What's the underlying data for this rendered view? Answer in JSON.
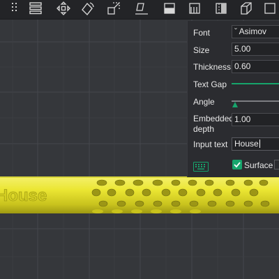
{
  "toolbar": {
    "tools": [
      {
        "icon": "grip-icon"
      },
      {
        "icon": "menu-icon"
      },
      {
        "icon": "move-icon"
      },
      {
        "icon": "rotate-icon"
      },
      {
        "icon": "scale-icon"
      },
      {
        "icon": "lay-flat-icon"
      },
      {
        "icon": "cut-icon"
      },
      {
        "icon": "support-paint-icon"
      },
      {
        "icon": "seam-paint-icon"
      },
      {
        "icon": "color-paint-icon"
      },
      {
        "icon": "measure-icon"
      },
      {
        "icon": "text-shape-icon"
      }
    ]
  },
  "panel": {
    "font_label": "Font",
    "font_value": "Asimov",
    "size_label": "Size",
    "size_value": "5.00",
    "thickness_label": "Thickness",
    "thickness_value": "0.60",
    "text_gap_label": "Text Gap",
    "angle_label": "Angle",
    "embedded_label_line1": "Embedded",
    "embedded_label_line2": "depth",
    "embedded_value": "1.00",
    "input_text_label": "Input text",
    "input_text_value": "House",
    "surface_label": "Surface",
    "surface_checked": true
  },
  "model": {
    "embossed_text": "House",
    "color": "#e9e42c"
  },
  "colors": {
    "accent": "#16a56c",
    "background": "#35373b",
    "panel": "#2b2c30"
  }
}
